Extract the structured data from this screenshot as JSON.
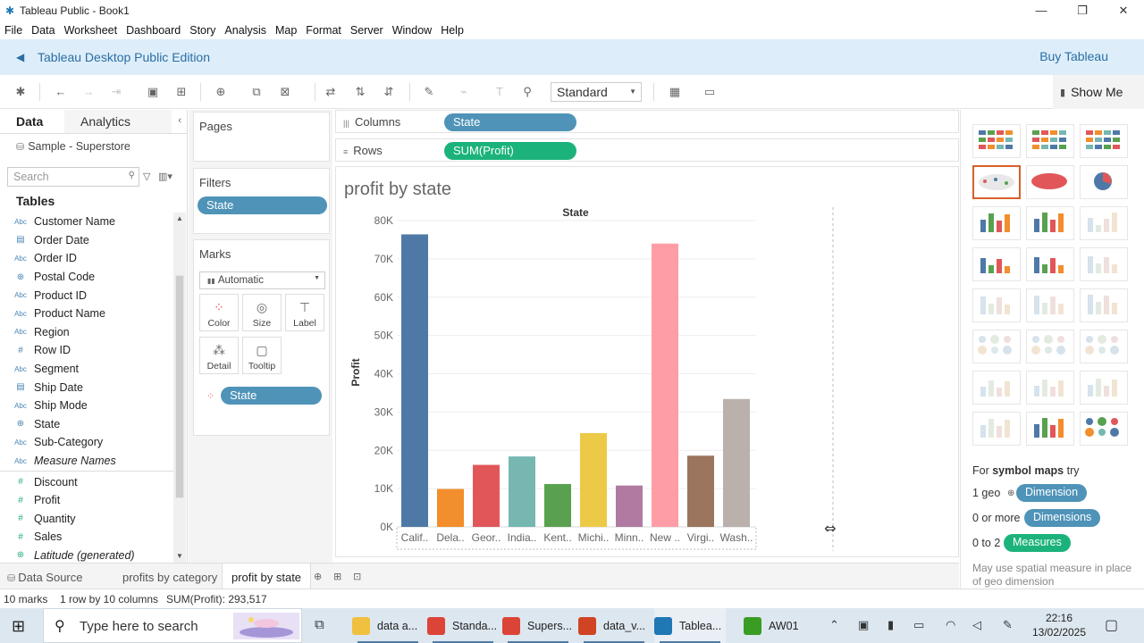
{
  "window": {
    "title": "Tableau Public - Book1"
  },
  "menu": [
    "File",
    "Data",
    "Worksheet",
    "Dashboard",
    "Story",
    "Analysis",
    "Map",
    "Format",
    "Server",
    "Window",
    "Help"
  ],
  "banner": {
    "edition": "Tableau Desktop Public Edition",
    "buy": "Buy Tableau"
  },
  "toolbar": {
    "fit": "Standard",
    "show_me": "Show Me"
  },
  "data_pane": {
    "tab_data": "Data",
    "tab_analytics": "Analytics",
    "source": "Sample - Superstore",
    "search_placeholder": "Search",
    "tables_label": "Tables",
    "dimensions": [
      {
        "type": "Abc",
        "name": "Customer Name"
      },
      {
        "type": "date",
        "name": "Order Date"
      },
      {
        "type": "Abc",
        "name": "Order ID"
      },
      {
        "type": "geo",
        "name": "Postal Code"
      },
      {
        "type": "Abc",
        "name": "Product ID"
      },
      {
        "type": "Abc",
        "name": "Product Name"
      },
      {
        "type": "Abc",
        "name": "Region"
      },
      {
        "type": "#",
        "name": "Row ID"
      },
      {
        "type": "Abc",
        "name": "Segment"
      },
      {
        "type": "date",
        "name": "Ship Date"
      },
      {
        "type": "Abc",
        "name": "Ship Mode"
      },
      {
        "type": "geo",
        "name": "State"
      },
      {
        "type": "Abc",
        "name": "Sub-Category"
      },
      {
        "type": "Abc",
        "name": "Measure Names"
      }
    ],
    "measures": [
      {
        "type": "#",
        "name": "Discount"
      },
      {
        "type": "#",
        "name": "Profit"
      },
      {
        "type": "#",
        "name": "Quantity"
      },
      {
        "type": "#",
        "name": "Sales"
      },
      {
        "type": "geo",
        "name": "Latitude (generated)"
      }
    ]
  },
  "cards": {
    "pages": "Pages",
    "filters": "Filters",
    "filter_pill": "State",
    "marks": "Marks",
    "mark_type": "Automatic",
    "buttons": [
      "Color",
      "Size",
      "Label",
      "Detail",
      "Tooltip"
    ],
    "marks_pill": "State"
  },
  "shelves": {
    "columns_label": "Columns",
    "columns_pill": "State",
    "rows_label": "Rows",
    "rows_pill": "SUM(Profit)"
  },
  "view": {
    "title": "profit by state"
  },
  "chart_data": {
    "type": "bar",
    "title": "State",
    "xlabel": "",
    "ylabel": "Profit",
    "categories": [
      "Calif..",
      "Dela..",
      "Geor..",
      "India..",
      "Kent..",
      "Michi..",
      "Minn..",
      "New ..",
      "Virgi..",
      "Wash.."
    ],
    "values": [
      76400,
      9900,
      16200,
      18400,
      11200,
      24500,
      10800,
      74000,
      18600,
      33400
    ],
    "colors": [
      "#4e79a7",
      "#f28e2b",
      "#e15759",
      "#76b7b2",
      "#59a14f",
      "#edc948",
      "#b07aa1",
      "#ff9da7",
      "#9c755f",
      "#bab0ac"
    ],
    "ylim": [
      0,
      80000
    ],
    "yticks": [
      "0K",
      "10K",
      "20K",
      "30K",
      "40K",
      "50K",
      "60K",
      "70K",
      "80K"
    ],
    "grid": true
  },
  "show_me": {
    "hint_prefix": "For",
    "hint_bold": "symbol maps",
    "hint_suffix": "try",
    "req1_count": "1 geo",
    "req1_pill": "Dimension",
    "req2_count": "0 or more",
    "req2_pill": "Dimensions",
    "req3_count": "0 to 2",
    "req3_pill": "Measures",
    "note": "May use spatial measure in place of geo dimension"
  },
  "sheet_tabs": {
    "data_source": "Data Source",
    "sheet1": "profits by category",
    "sheet2": "profit by state"
  },
  "status": {
    "marks": "10 marks",
    "dims": "1 row by 10 columns",
    "sum": "SUM(Profit): 293,517"
  },
  "taskbar": {
    "search_placeholder": "Type here to search",
    "apps": [
      {
        "label": "data a...",
        "color": "#f0c040"
      },
      {
        "label": "Standa...",
        "color": "#db4437"
      },
      {
        "label": "Supers...",
        "color": "#db4437"
      },
      {
        "label": "data_v...",
        "color": "#d04423"
      },
      {
        "label": "Tablea...",
        "color": "#1f77b4"
      },
      {
        "label": "AW01",
        "color": "#3a9d23"
      }
    ],
    "time": "22:16",
    "date": "13/02/2025"
  }
}
